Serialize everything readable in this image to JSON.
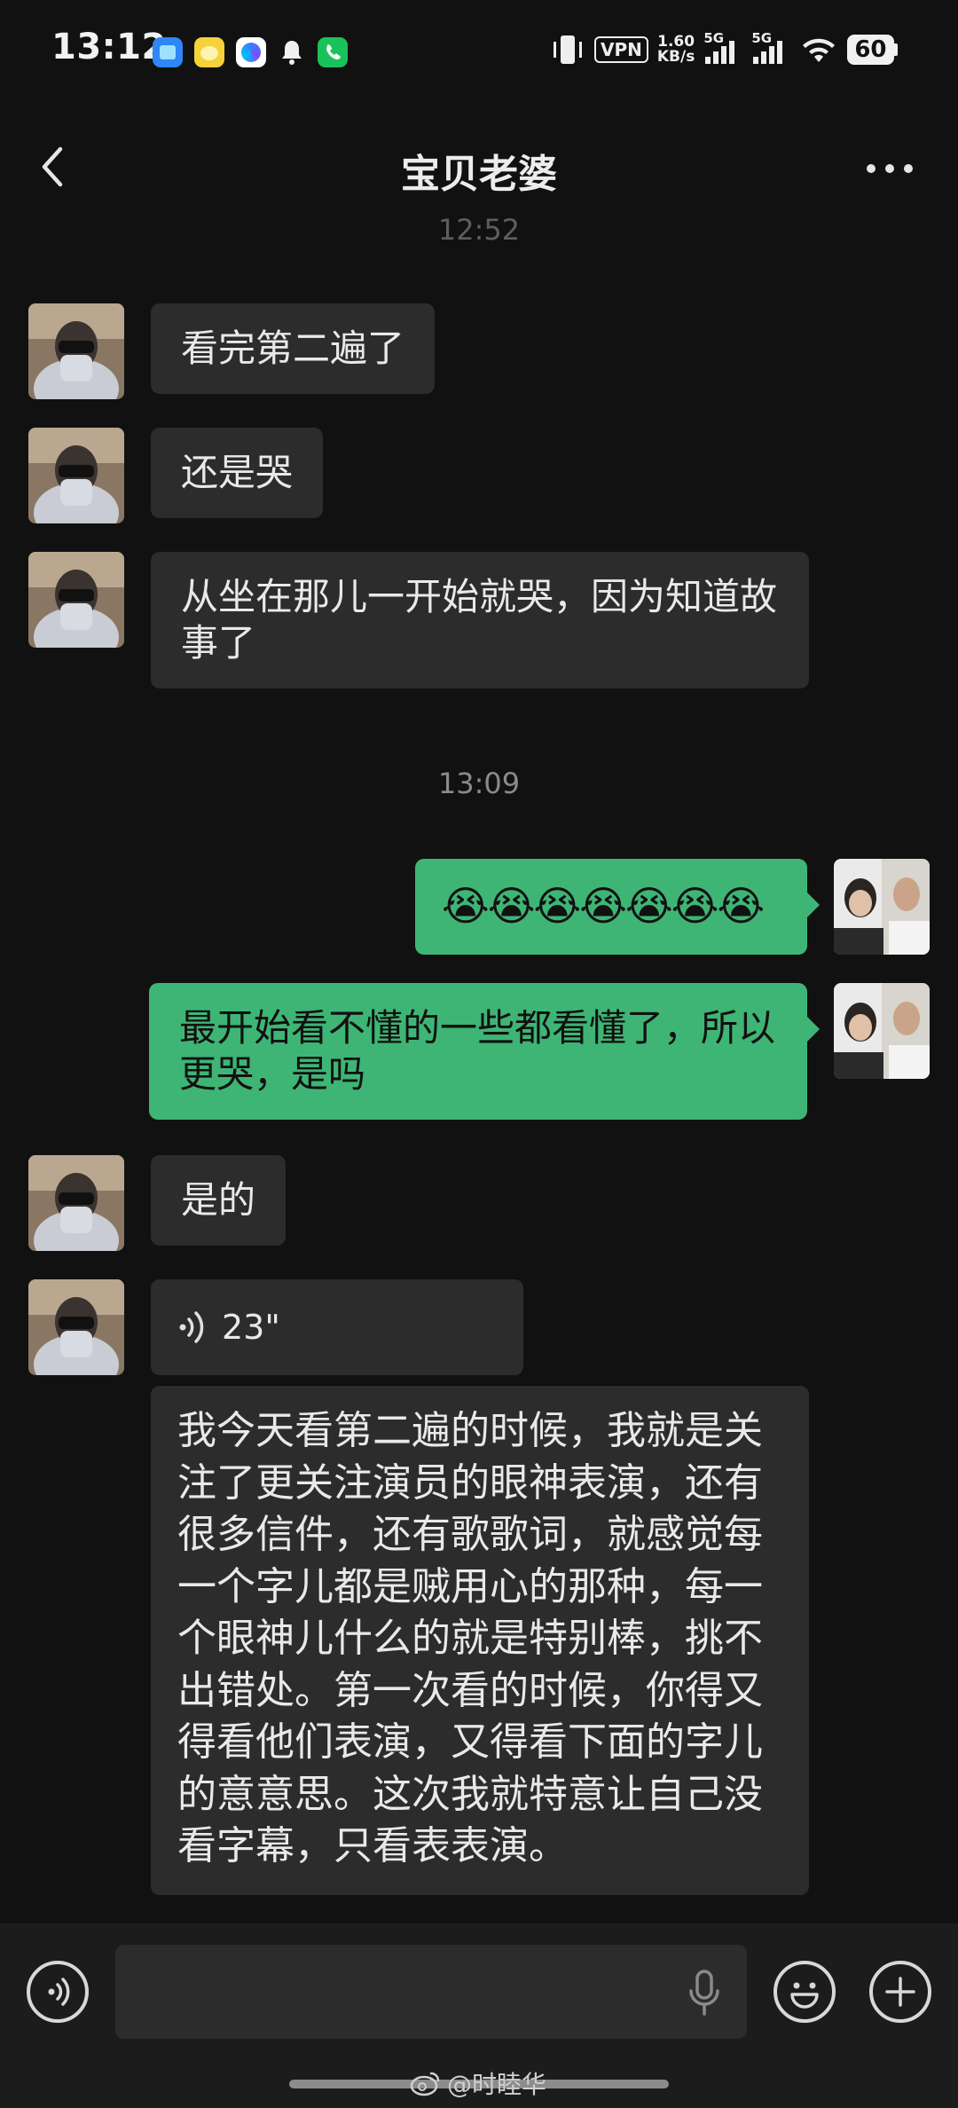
{
  "status_bar": {
    "time": "13:12",
    "vpn": "VPN",
    "speed_value": "1.60",
    "speed_unit": "KB/s",
    "signal1": "5G",
    "signal2": "5G",
    "battery": "60",
    "icons": [
      "app-icon-blue",
      "app-icon-yellow",
      "app-icon-multicolor",
      "bell-icon",
      "phone-icon",
      "vibrate-icon",
      "signal-icon",
      "wifi-icon",
      "battery-icon"
    ]
  },
  "header": {
    "title": "宝贝老婆",
    "back_icon": "back-chevron-icon",
    "more_icon": "more-dots-icon"
  },
  "chat": {
    "top_timestamp": "12:52",
    "timestamp2": "13:09",
    "messages": [
      {
        "side": "in",
        "text": "看完第二遍了"
      },
      {
        "side": "in",
        "text": "还是哭"
      },
      {
        "side": "in",
        "text": "从坐在那儿一开始就哭，因为知道故事了"
      },
      {
        "side": "out",
        "text": "😭😭😭😭😭😭😭"
      },
      {
        "side": "out",
        "text": "最开始看不懂的一些都看懂了，所以更哭，是吗"
      },
      {
        "side": "in",
        "text": "是的"
      },
      {
        "side": "in",
        "type": "voice",
        "duration": "23\""
      },
      {
        "side": "in",
        "type": "transcript",
        "text": "我今天看第二遍的时候，我就是关注了更关注演员的眼神表演，还有很多信件，还有歌歌词，就感觉每一个字儿都是贼用心的那种，每一个眼神儿什么的就是特别棒，挑不出错处。第一次看的时候，你得又得看他们表演，又得看下面的字儿的意意思。这次我就特意让自己没看字幕，只看表表演。"
      }
    ]
  },
  "bottom_bar": {
    "voice_icon": "voice-input-icon",
    "mic_icon": "microphone-icon",
    "emoji_icon": "emoji-icon",
    "plus_icon": "plus-icon",
    "watermark": "@时睦华"
  },
  "colors": {
    "background": "#111111",
    "bubble_in": "#2c2c2c",
    "bubble_out": "#3eb575"
  }
}
